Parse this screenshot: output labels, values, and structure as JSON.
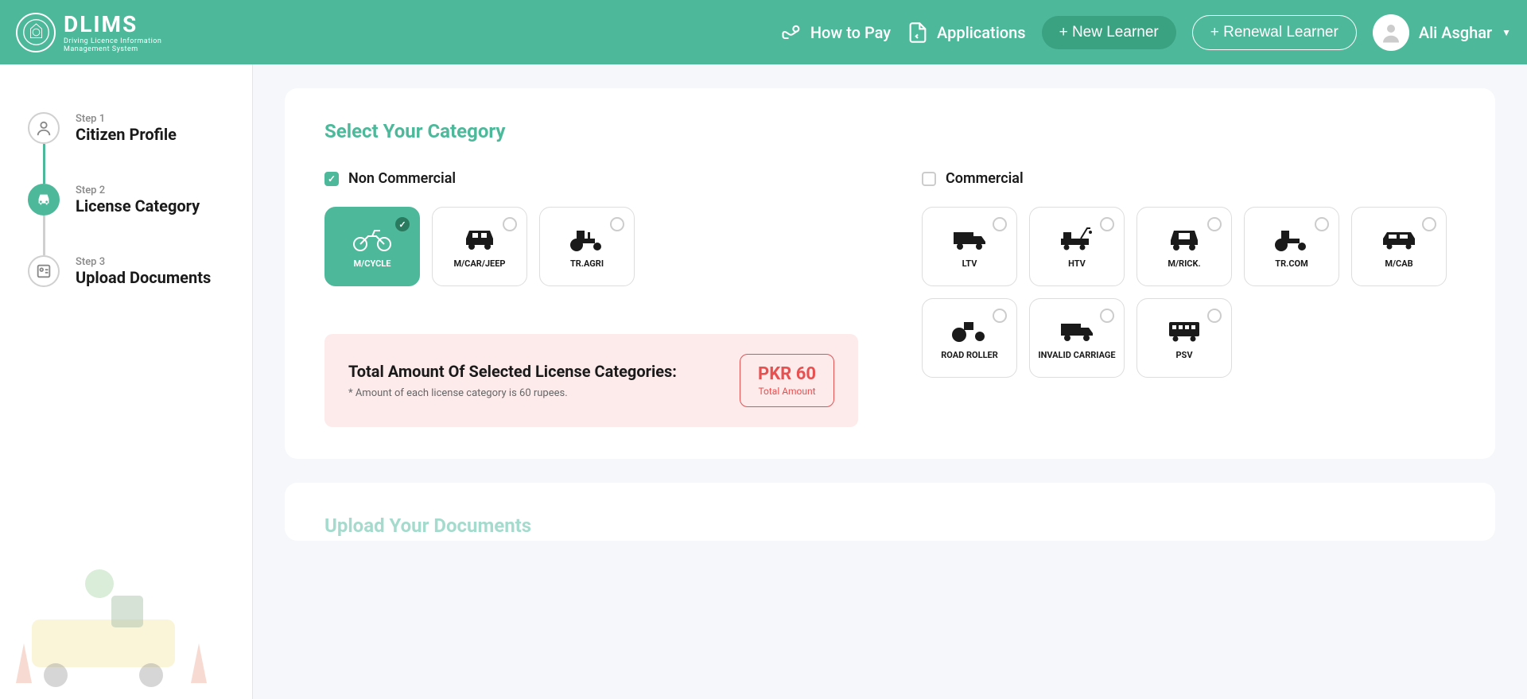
{
  "header": {
    "logo_title": "DLIMS",
    "logo_subtitle_line1": "Driving Licence Information",
    "logo_subtitle_line2": "Management System",
    "nav": {
      "how_to_pay": "How to Pay",
      "applications": "Applications",
      "new_learner": "+ New Learner",
      "renewal_learner": "+ Renewal Learner"
    },
    "user_name": "Ali Asghar"
  },
  "sidebar": {
    "steps": [
      {
        "step": "Step 1",
        "title": "Citizen Profile"
      },
      {
        "step": "Step 2",
        "title": "License Category"
      },
      {
        "step": "Step 3",
        "title": "Upload Documents"
      }
    ]
  },
  "main": {
    "category_title": "Select Your Category",
    "non_commercial_label": "Non Commercial",
    "commercial_label": "Commercial",
    "non_commercial_vehicles": [
      {
        "label": "M/CYCLE",
        "selected": true
      },
      {
        "label": "M/CAR/JEEP",
        "selected": false
      },
      {
        "label": "TR.AGRI",
        "selected": false
      }
    ],
    "commercial_vehicles": [
      {
        "label": "LTV"
      },
      {
        "label": "HTV"
      },
      {
        "label": "M/RICK."
      },
      {
        "label": "TR.COM"
      },
      {
        "label": "M/CAB"
      },
      {
        "label": "ROAD ROLLER"
      },
      {
        "label": "INVALID CARRIAGE"
      },
      {
        "label": "PSV"
      }
    ],
    "amount": {
      "title": "Total Amount Of Selected License Categories:",
      "note": "* Amount of each license category is 60 rupees.",
      "value": "PKR 60",
      "label": "Total Amount"
    },
    "upload_title": "Upload Your Documents"
  }
}
